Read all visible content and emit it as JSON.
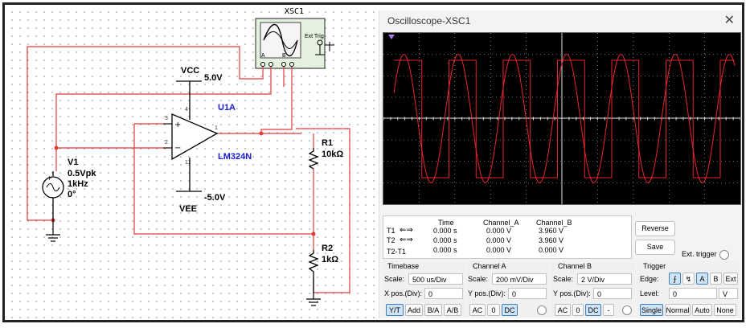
{
  "schematic": {
    "scope_label": "XSC1",
    "scope_ext_trig": "Ext Trig",
    "scope_ch_a": "A",
    "scope_ch_b": "B",
    "vcc_name": "VCC",
    "vcc_value": "5.0V",
    "vee_name": "VEE",
    "vee_value": "-5.0V",
    "opamp_ref": "U1A",
    "opamp_model": "LM324N",
    "pin_4": "4",
    "pin_3": "3",
    "pin_2": "2",
    "pin_1": "1",
    "pin_11": "11",
    "v1_name": "V1",
    "v1_amp": "0.5Vpk",
    "v1_freq": "1kHz",
    "v1_phase": "0°",
    "r1_name": "R1",
    "r1_value": "10kΩ",
    "r2_name": "R2",
    "r2_value": "1kΩ"
  },
  "scope": {
    "title": "Oscilloscope-XSC1",
    "close_icon": "close-icon",
    "trace_color": "#e8252f",
    "readout": {
      "headers": [
        "Time",
        "Channel_A",
        "Channel_B"
      ],
      "rows": [
        {
          "label": "T1",
          "time": "0.000 s",
          "a": "0.000 V",
          "b": "3.960 V"
        },
        {
          "label": "T2",
          "time": "0.000 s",
          "a": "0.000 V",
          "b": "3.960 V"
        },
        {
          "label": "T2-T1",
          "time": "0.000 s",
          "a": "0.000 V",
          "b": "0.000 V"
        }
      ]
    },
    "reverse_label": "Reverse",
    "save_label": "Save",
    "ext_trigger_label": "Ext. trigger",
    "timebase": {
      "heading": "Timebase",
      "scale_label": "Scale:",
      "scale_value": "500 us/Div",
      "xpos_label": "X pos.(Div):",
      "xpos_value": "0",
      "buttons": [
        "Y/T",
        "Add",
        "B/A",
        "A/B"
      ]
    },
    "channel_a": {
      "heading": "Channel A",
      "scale_label": "Scale:",
      "scale_value": "200 mV/Div",
      "ypos_label": "Y pos.(Div):",
      "ypos_value": "0",
      "buttons": [
        "AC",
        "0",
        "DC"
      ]
    },
    "channel_b": {
      "heading": "Channel B",
      "scale_label": "Scale:",
      "scale_value": "2  V/Div",
      "ypos_label": "Y pos.(Div):",
      "ypos_value": "0",
      "buttons": [
        "AC",
        "0",
        "DC",
        "-"
      ]
    },
    "trigger": {
      "heading": "Trigger",
      "edge_label": "Edge:",
      "edge_buttons": [
        "A",
        "B",
        "Ext"
      ],
      "level_label": "Level:",
      "level_value": "0",
      "level_unit": "V",
      "mode_buttons": [
        "Single",
        "Normal",
        "Auto",
        "None"
      ]
    }
  }
}
